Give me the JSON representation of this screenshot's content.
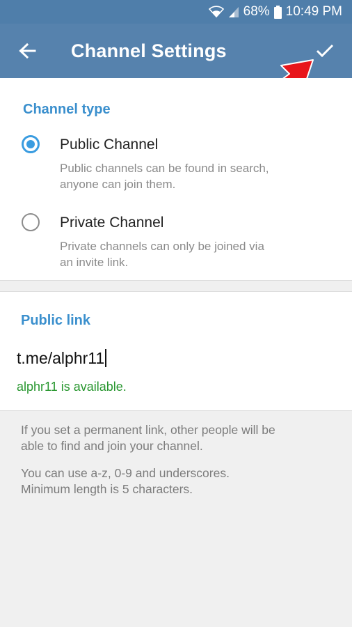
{
  "status_bar": {
    "battery": "68%",
    "time": "10:49 PM",
    "icons": [
      "wifi-icon",
      "signal-icon",
      "battery-icon"
    ]
  },
  "app_bar": {
    "title": "Channel Settings",
    "back_icon": "back-arrow-icon",
    "done_icon": "checkmark-icon",
    "color": "#5682ad"
  },
  "channel_type": {
    "heading": "Channel type",
    "options": [
      {
        "label": "Public Channel",
        "description": "Public channels can be found in search, anyone can join them.",
        "description_lines": [
          "Public channels can be found in search,",
          "anyone can join them."
        ],
        "selected": true
      },
      {
        "label": "Private Channel",
        "description": "Private channels can only be joined via an invite link.",
        "description_lines": [
          "Private channels can only be joined via",
          "an invite link."
        ],
        "selected": false
      }
    ]
  },
  "public_link": {
    "heading": "Public link",
    "value": "t.me/alphr11",
    "availability": "alphr11 is available.",
    "availability_color": "#27962e"
  },
  "info": {
    "para1_lines": [
      "If you set a permanent link, other people will be",
      "able to find and join your channel."
    ],
    "para2_lines": [
      "You can use a-z, 0-9 and underscores.",
      "Minimum length is 5 characters."
    ]
  },
  "accent_color": "#3a8fcd",
  "annotation": {
    "icon": "red-pointer-arrow-icon",
    "color": "#e8151b"
  }
}
